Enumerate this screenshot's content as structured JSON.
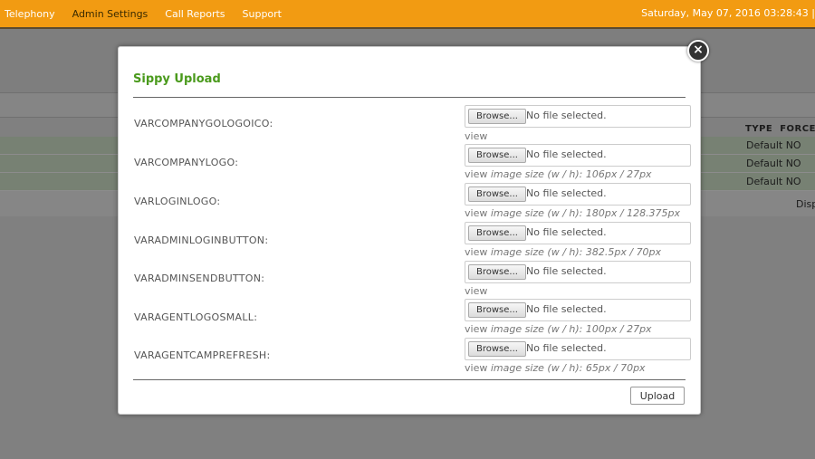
{
  "nav": {
    "items": [
      "Telephony",
      "Admin Settings",
      "Call Reports",
      "Support"
    ],
    "active_index": 1,
    "clock": "Saturday, May 07, 2016 03:28:43 |"
  },
  "background": {
    "col_type": "TYPE",
    "col_force": "FORCE",
    "rows": [
      {
        "type": "Default",
        "force": "NO"
      },
      {
        "type": "Default",
        "force": "NO"
      },
      {
        "type": "Default",
        "force": "NO"
      }
    ],
    "disp": "Disp"
  },
  "modal": {
    "title": "Sippy Upload",
    "browse_label": "Browse...",
    "no_file_text": "No file selected.",
    "view_label": "view",
    "upload_label": "Upload",
    "fields": [
      {
        "label": "VARCOMPANYGOLOGOICO:",
        "size": ""
      },
      {
        "label": "VARCOMPANYLOGO:",
        "size": "image size (w / h): 106px / 27px"
      },
      {
        "label": "VARLOGINLOGO:",
        "size": "image size (w / h): 180px / 128.375px"
      },
      {
        "label": "VARADMINLOGINBUTTON:",
        "size": "image size (w / h): 382.5px / 70px"
      },
      {
        "label": "VARADMINSENDBUTTON:",
        "size": ""
      },
      {
        "label": "VARAGENTLOGOSMALL:",
        "size": "image size (w / h): 100px / 27px"
      },
      {
        "label": "VARAGENTCAMPREFRESH:",
        "size": "image size (w / h): 65px / 70px"
      }
    ]
  },
  "colors": {
    "topbar": "#f29b12",
    "title_green": "#4a9a1c",
    "row_green": "#d9ecd2"
  }
}
